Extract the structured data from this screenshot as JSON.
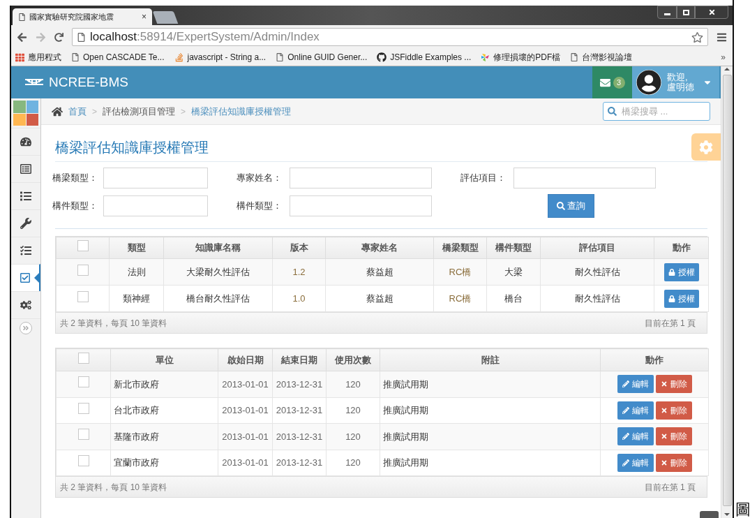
{
  "browser": {
    "tab": {
      "title": "國家實驗研究院國家地震",
      "close": "×",
      "selected": true
    },
    "address": {
      "host": "localhost",
      "path": ":58914/ExpertSystem/Admin/Index"
    },
    "bookmarks": [
      {
        "kind": "apps",
        "label": "應用程式"
      },
      {
        "kind": "page",
        "label": "Open CASCADE Te..."
      },
      {
        "kind": "stack",
        "label": "javascript - String a..."
      },
      {
        "kind": "page",
        "label": "Online GUID Gener..."
      },
      {
        "kind": "github",
        "label": "JSFiddle Examples ..."
      },
      {
        "kind": "pinwheel",
        "label": "修理損壞的PDF檔"
      },
      {
        "kind": "page",
        "label": "台灣影視論壇"
      }
    ],
    "bookmarks_more": "»"
  },
  "header": {
    "brand": "NCREE-BMS",
    "mail_count": "3",
    "greeting": "歡迎,",
    "user": "盧明德"
  },
  "sidebar": {
    "items": [
      {
        "kind": "dashboard",
        "selected": false
      },
      {
        "kind": "form",
        "selected": false
      },
      {
        "kind": "list",
        "selected": false
      },
      {
        "kind": "wrench",
        "selected": false
      },
      {
        "kind": "tasks",
        "selected": false
      },
      {
        "kind": "check",
        "selected": true
      },
      {
        "kind": "cogs",
        "selected": false
      }
    ]
  },
  "breadcrumb": [
    {
      "label": "首頁",
      "link": true
    },
    {
      "separator": ">",
      "label": "評估檢測項目管理",
      "link": false
    },
    {
      "separator": ">",
      "label": "橋梁評估知識庫授權管理",
      "link": true
    }
  ],
  "search": {
    "placeholder": "橋梁搜尋 ..."
  },
  "page_title": "橋梁評估知識庫授權管理",
  "filters": [
    {
      "label": "橋梁類型："
    },
    {
      "label": "專家姓名："
    },
    {
      "label": "評估項目："
    },
    {
      "label": "構件類型："
    },
    {
      "label": "構件類型："
    }
  ],
  "query_button": "查詢",
  "knowledge_table": {
    "header_checked": false,
    "columns": [
      "類型",
      "知識庫名稱",
      "版本",
      "專家姓名",
      "橋梁類型",
      "構件類型",
      "評估項目",
      "動作"
    ],
    "rows": [
      {
        "checked": false,
        "cells": [
          "法則",
          "大梁耐久性評估",
          "1.2",
          "蔡益超",
          "RC橋",
          "大梁",
          "耐久性評估"
        ],
        "action": "授權"
      },
      {
        "checked": false,
        "cells": [
          "類神經",
          "橋台耐久性評估",
          "1.0",
          "蔡益超",
          "RC橋",
          "橋台",
          "耐久性評估"
        ],
        "action": "授權"
      }
    ],
    "summary": "共 2 筆資料，每頁 10 筆資料",
    "page": "目前在第 1 頁"
  },
  "unit_table": {
    "header_checked": false,
    "columns": [
      "單位",
      "啟始日期",
      "結束日期",
      "使用次數",
      "附註",
      "動作"
    ],
    "rows": [
      {
        "checked": false,
        "cells": [
          "新北市政府",
          "2013-01-01",
          "2013-12-31",
          "120",
          "推廣試用期"
        ],
        "edit": "編輯",
        "delete": "刪除"
      },
      {
        "checked": false,
        "cells": [
          "台北市政府",
          "2013-01-01",
          "2013-12-31",
          "120",
          "推廣試用期"
        ],
        "edit": "編輯",
        "delete": "刪除"
      },
      {
        "checked": false,
        "cells": [
          "基隆市政府",
          "2013-01-01",
          "2013-12-31",
          "120",
          "推廣試用期"
        ],
        "edit": "編輯",
        "delete": "刪除"
      },
      {
        "checked": false,
        "cells": [
          "宜蘭市政府",
          "2013-01-01",
          "2013-12-31",
          "120",
          "推廣試用期"
        ],
        "edit": "編輯",
        "delete": "刪除"
      }
    ],
    "summary": "共 2 筆資料，每頁 10 筆資料",
    "page": "目前在第 1 頁"
  },
  "caption_fragment": "圖"
}
